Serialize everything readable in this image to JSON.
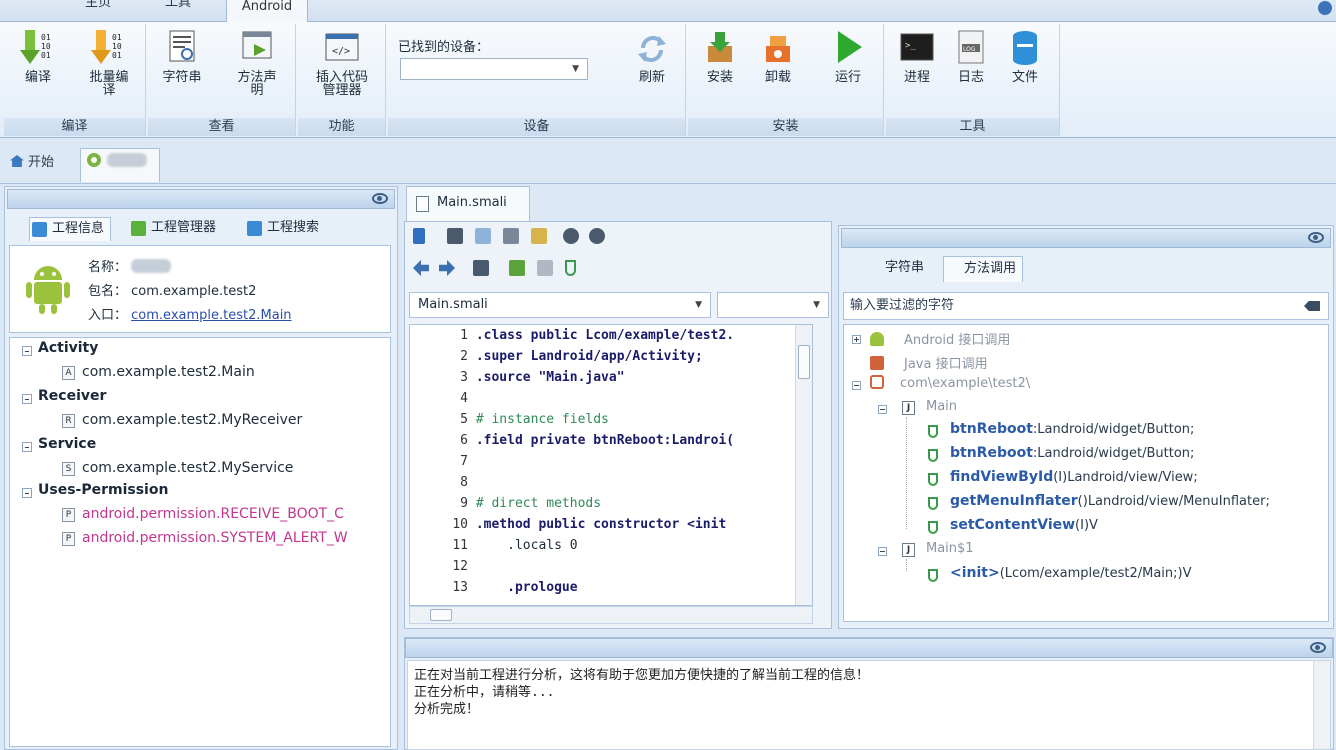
{
  "ribbon_tabs": [
    "主页",
    "工具",
    "Android"
  ],
  "ribbon": {
    "groups": [
      {
        "label": "编译",
        "buttons": [
          "编译",
          "批量编译"
        ]
      },
      {
        "label": "查看",
        "buttons": [
          "字符串",
          "方法声明"
        ]
      },
      {
        "label": "功能",
        "buttons": [
          "插入代码管理器"
        ]
      },
      {
        "label": "设备",
        "buttons": [
          "刷新"
        ]
      },
      {
        "label": "安装",
        "buttons": [
          "安装",
          "卸载",
          "运行"
        ]
      },
      {
        "label": "工具",
        "buttons": [
          "进程",
          "日志",
          "文件"
        ]
      }
    ],
    "device_label": "已找到的设备：",
    "device_value": ""
  },
  "doc_tabs": {
    "home": "开始"
  },
  "left_panel": {
    "tabs": [
      "工程信息",
      "工程管理器",
      "工程搜索"
    ],
    "info": {
      "name_label": "名称：",
      "package_label": "包名：",
      "package_value": "com.example.test2",
      "entry_label": "入口：",
      "entry_value": "com.example.test2.Main"
    },
    "tree": {
      "activity": "Activity",
      "activity_item": "com.example.test2.Main",
      "receiver": "Receiver",
      "receiver_item": "com.example.test2.MyReceiver",
      "service": "Service",
      "service_item": "com.example.test2.MyService",
      "uses_permission": "Uses-Permission",
      "perm1": "android.permission.RECEIVE_BOOT_C",
      "perm2": "android.permission.SYSTEM_ALERT_W"
    }
  },
  "editor": {
    "tab": "Main.smali",
    "combo_file": "Main.smali",
    "combo_member": "",
    "lines": [
      {
        "n": "1",
        "text": ".class public Lcom/example/test2."
      },
      {
        "n": "2",
        "text": ".super Landroid/app/Activity;"
      },
      {
        "n": "3",
        "text": ".source \"Main.java\""
      },
      {
        "n": "4",
        "text": ""
      },
      {
        "n": "5",
        "text": "# instance fields"
      },
      {
        "n": "6",
        "text": ".field private btnReboot:Landroi("
      },
      {
        "n": "7",
        "text": ""
      },
      {
        "n": "8",
        "text": ""
      },
      {
        "n": "9",
        "text": "# direct methods"
      },
      {
        "n": "10",
        "text": ".method public constructor <init"
      },
      {
        "n": "11",
        "text": "    .locals 0"
      },
      {
        "n": "12",
        "text": ""
      },
      {
        "n": "13",
        "text": "    .prologue"
      }
    ]
  },
  "right_panel": {
    "tabs": [
      "字符串",
      "方法调用"
    ],
    "filter_placeholder": "输入要过滤的字符",
    "tree": {
      "android_api": "Android 接口调用",
      "java_api": "Java 接口调用",
      "package": "com\\example\\test2\\",
      "main_class": "Main",
      "methods": [
        {
          "name": "btnReboot",
          "sig": ":Landroid/widget/Button;"
        },
        {
          "name": "btnReboot",
          "sig": ":Landroid/widget/Button;"
        },
        {
          "name": "findViewById",
          "sig": "(I)Landroid/view/View;"
        },
        {
          "name": "getMenuInflater",
          "sig": "()Landroid/view/MenuInflater;"
        },
        {
          "name": "setContentView",
          "sig": "(I)V"
        }
      ],
      "main1_class": "Main$1",
      "init_name": "<init>",
      "init_sig": "(Lcom/example/test2/Main;)V"
    }
  },
  "output": {
    "lines": [
      "正在对当前工程进行分析，这将有助于您更加方便快捷的了解当前工程的信息！",
      "正在分析中，请稍等...",
      "分析完成！"
    ]
  }
}
